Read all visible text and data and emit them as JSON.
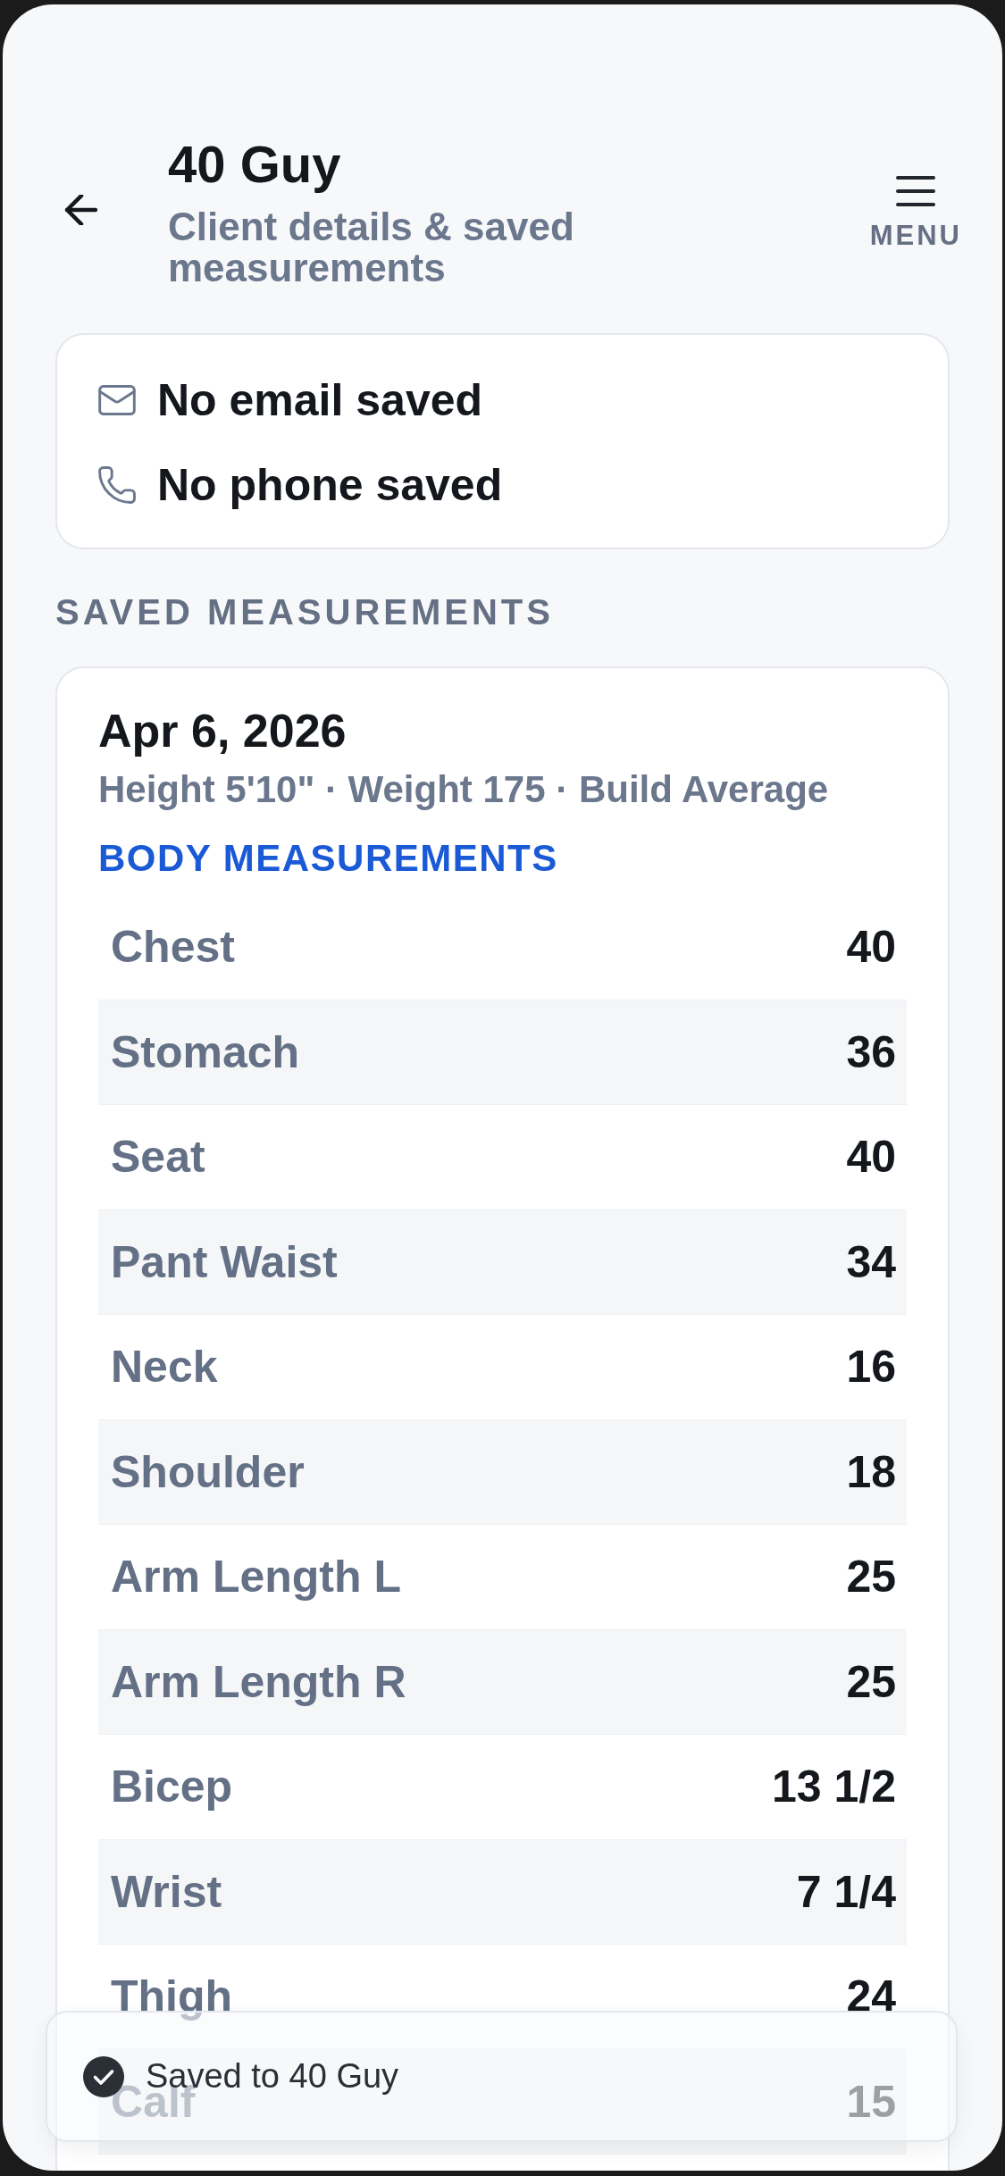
{
  "header": {
    "title": "40 Guy",
    "subtitle": "Client details & saved measurements",
    "menu_label": "MENU"
  },
  "contact": [
    {
      "kind": "email",
      "text": "No email saved"
    },
    {
      "kind": "phone",
      "text": "No phone saved"
    }
  ],
  "section_title": "SAVED MEASUREMENTS",
  "measurement_card": {
    "date": "Apr 6, 2026",
    "summary": "Height 5'10\" · Weight 175 · Build Average",
    "group_title": "BODY MEASUREMENTS",
    "rows": [
      {
        "label": "Chest",
        "value": "40"
      },
      {
        "label": "Stomach",
        "value": "36"
      },
      {
        "label": "Seat",
        "value": "40"
      },
      {
        "label": "Pant Waist",
        "value": "34"
      },
      {
        "label": "Neck",
        "value": "16"
      },
      {
        "label": "Shoulder",
        "value": "18"
      },
      {
        "label": "Arm Length L",
        "value": "25"
      },
      {
        "label": "Arm Length R",
        "value": "25"
      },
      {
        "label": "Bicep",
        "value": "13 1/2"
      },
      {
        "label": "Wrist",
        "value": "7 1/4"
      },
      {
        "label": "Thigh",
        "value": "24"
      },
      {
        "label": "Calf",
        "value": "15"
      }
    ]
  },
  "toast": {
    "message": "Saved to 40 Guy"
  }
}
